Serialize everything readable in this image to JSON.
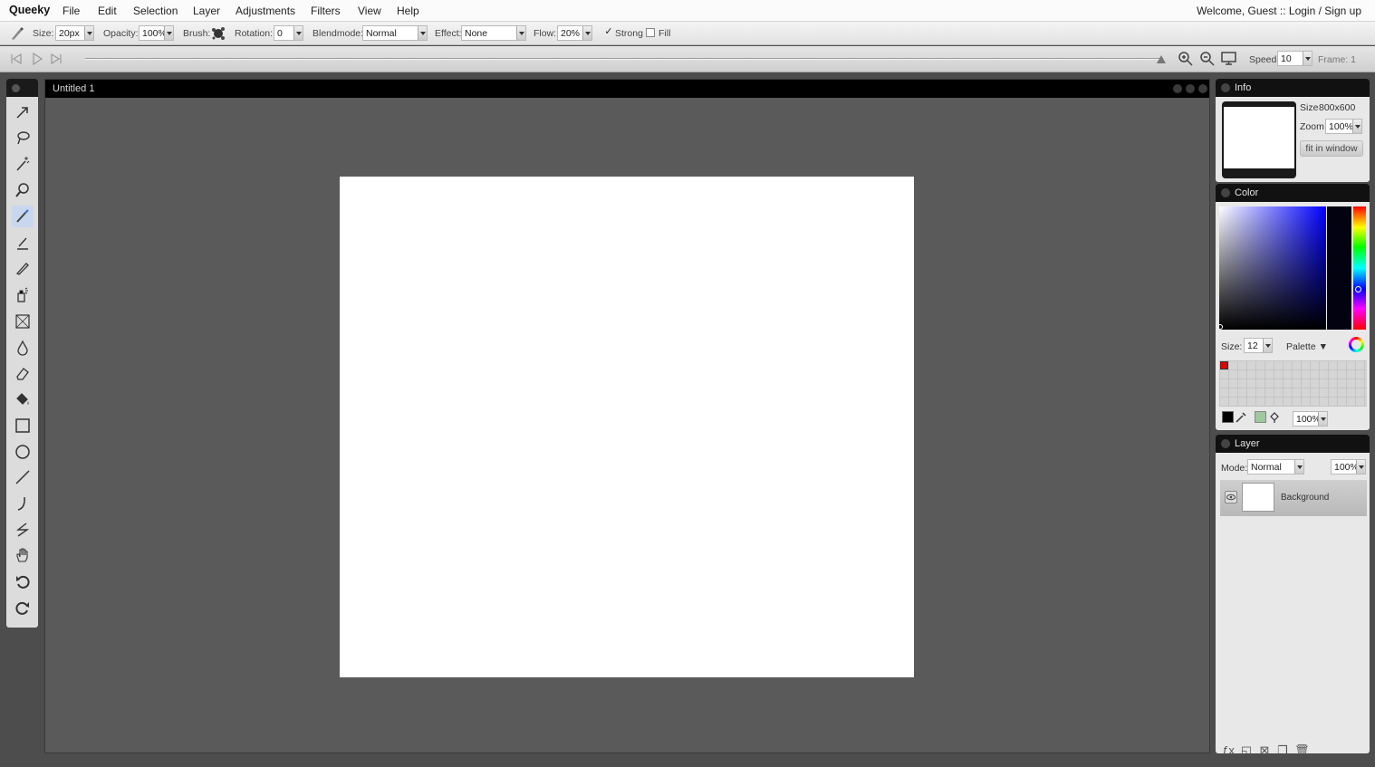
{
  "app": {
    "brand": "Queeky",
    "menus": [
      "File",
      "Edit",
      "Selection",
      "Layer",
      "Adjustments",
      "Filters",
      "View",
      "Help"
    ],
    "user": {
      "welcome": "Welcome, Guest ::",
      "login": "Login",
      "separator": "/",
      "signup": "Sign up"
    }
  },
  "options": {
    "size_label": "Size:",
    "size_value": "20px",
    "opacity_label": "Opacity:",
    "opacity_value": "100%",
    "brush_label": "Brush:",
    "rotation_label": "Rotation:",
    "rotation_value": "0",
    "blendmode_label": "Blendmode:",
    "blendmode_value": "Normal",
    "effect_label": "Effect:",
    "effect_value": "None",
    "flow_label": "Flow:",
    "flow_value": "20%",
    "strong_label": "Strong",
    "strong_checked": "✓",
    "fill_label": "Fill"
  },
  "timeline": {
    "speed_label": "Speed:",
    "speed_value": "10",
    "frame_label": "Frame: 1"
  },
  "tools": [
    "move-arrow-icon",
    "lasso-icon",
    "magic-wand-icon",
    "zoom-icon",
    "brush-icon",
    "smudge-icon",
    "pencil-icon",
    "spray-icon",
    "transform-icon",
    "blur-drop-icon",
    "eraser-icon",
    "paint-bucket-icon",
    "rectangle-icon",
    "ellipse-icon",
    "line-icon",
    "curve-icon",
    "polyline-icon",
    "hand-icon",
    "undo-icon",
    "redo-icon"
  ],
  "document": {
    "title": "Untitled 1"
  },
  "info_panel": {
    "title": "Info",
    "size_label": "Size",
    "size_value": "800x600",
    "zoom_label": "Zoom",
    "zoom_value": "100%",
    "fit_button": "fit in window"
  },
  "color_panel": {
    "title": "Color",
    "size_label": "Size:",
    "size_value": "12",
    "palette_label": "Palette ▼",
    "opacity_value": "100%",
    "hue_color": "#0000ff",
    "selected_swatch": "#e00000"
  },
  "layer_panel": {
    "title": "Layer",
    "mode_label": "Mode:",
    "mode_value": "Normal",
    "opacity_value": "100%",
    "layers": [
      {
        "name": "Background"
      }
    ]
  }
}
